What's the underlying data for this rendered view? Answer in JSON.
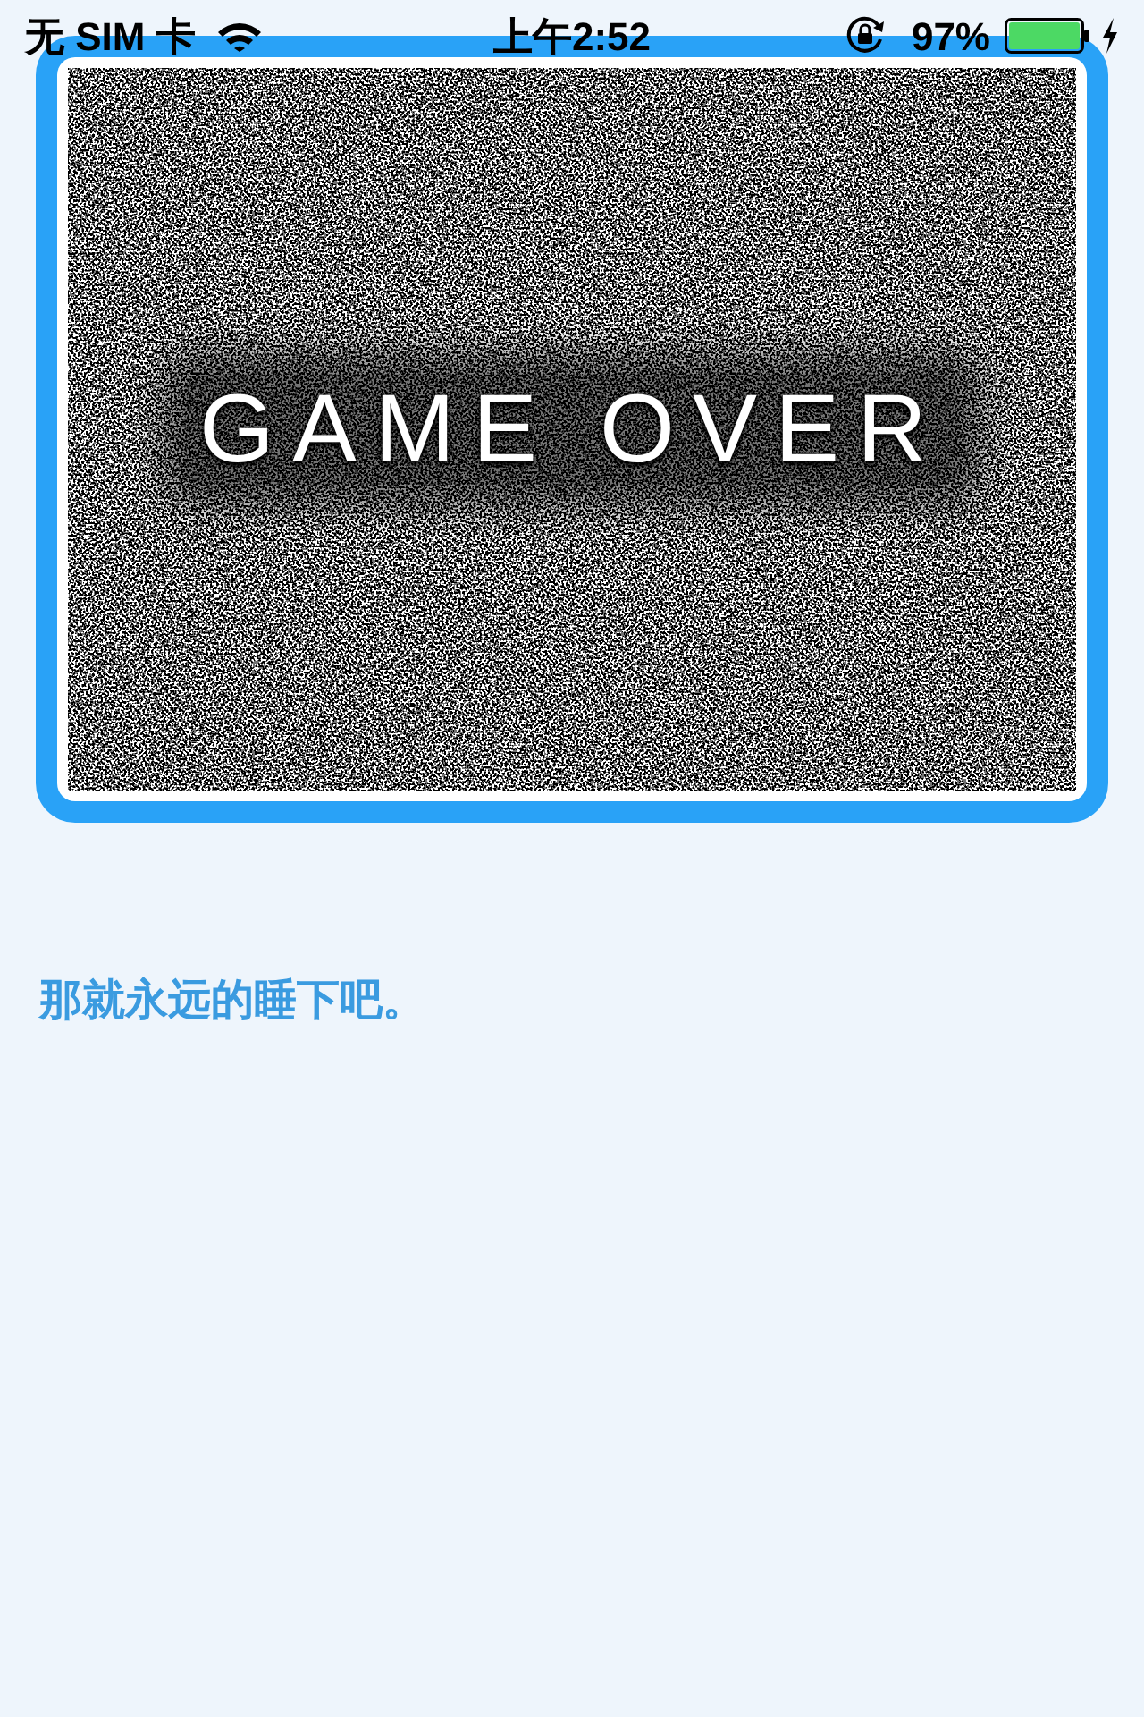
{
  "status_bar": {
    "carrier": "无 SIM 卡",
    "time": "上午2:52",
    "battery_percent": "97%"
  },
  "game_screen": {
    "title": "GAME OVER"
  },
  "message": "那就永远的睡下吧。"
}
